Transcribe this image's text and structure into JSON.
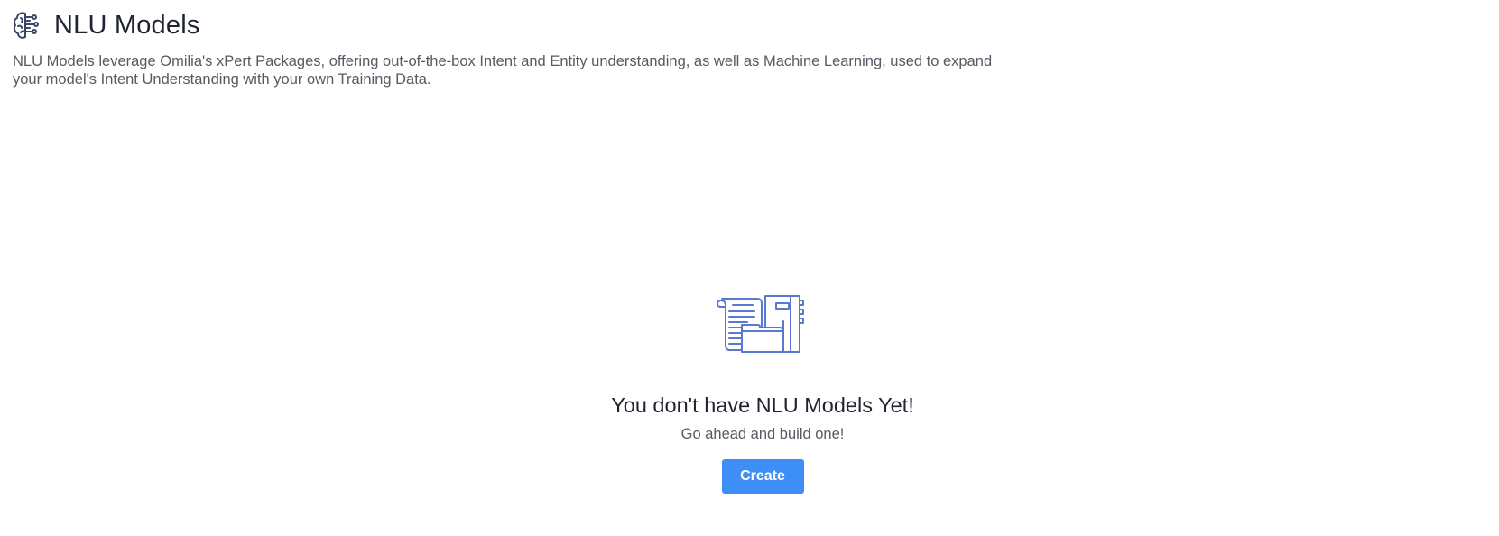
{
  "header": {
    "icon": "brain-icon",
    "title": "NLU Models",
    "description": "NLU Models leverage Omilia's xPert Packages, offering out-of-the-box Intent and Entity understanding, as well as Machine Learning, used to expand your model's Intent Understanding with your own Training Data."
  },
  "empty_state": {
    "illustration": "documents-illustration",
    "title": "You don't have NLU Models Yet!",
    "subtitle": "Go ahead and build one!",
    "create_label": "Create"
  },
  "colors": {
    "accent": "#3d8ff7",
    "illustration": "#5a78cf",
    "icon": "#3c4566"
  }
}
